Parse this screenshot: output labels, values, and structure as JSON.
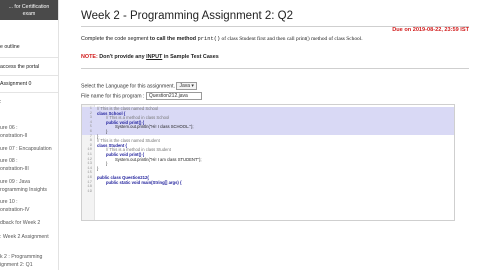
{
  "sidebar": {
    "header": [
      "... for Certification",
      "exam"
    ],
    "items": [
      {
        "text": "e outline",
        "style": "dark"
      },
      {
        "text": "access the portal",
        "style": "dark"
      },
      {
        "text": "Assignment 0",
        "style": "dark"
      },
      {
        "text": ":",
        "style": "dark"
      },
      {
        "text": "ure 06 :",
        "style": "muted"
      },
      {
        "text": "onstration-II",
        "style": "muted"
      },
      {
        "text": "ure 07 : Encapsulation",
        "style": "muted"
      },
      {
        "text": "ure 08 :",
        "style": "muted"
      },
      {
        "text": "onstration-III",
        "style": "muted"
      },
      {
        "text": "ure 09 : Java",
        "style": "muted"
      },
      {
        "text": "rogramming Insights",
        "style": "muted"
      },
      {
        "text": "ure 10 :",
        "style": "muted"
      },
      {
        "text": "onstration-IV",
        "style": "muted"
      },
      {
        "text": "dback for Week 2",
        "style": "muted"
      },
      {
        "text": ": Week 2 Assignment",
        "style": "muted"
      },
      {
        "text": "k 2 : Programming",
        "style": "muted"
      },
      {
        "text": "ignment 2: Q1",
        "style": "muted"
      }
    ]
  },
  "page": {
    "title": "Week 2 - Programming Assignment 2: Q2",
    "due": "Due on 2019-08-22, 23:59 IST",
    "instruction": {
      "before": "Complete the code segment ",
      "bold": "to call the method",
      "code": "print()",
      "after": " of class Student first and then call print() method of class School."
    },
    "note": {
      "label": "NOTE:",
      "before": " Don't provide any ",
      "input_word": "INPUT",
      "after": " in Sample Test Cases"
    },
    "language_label": "Select the Language for this assignment.",
    "language_value": "Java",
    "filename_label": "File name for this program :",
    "filename_value": "Question212.java"
  },
  "editor": {
    "lines": [
      {
        "n": "1",
        "text": "// This is the class named School",
        "type": "comment",
        "indent": 0,
        "hl": true
      },
      {
        "n": "2",
        "text": "class School {",
        "type": "kw",
        "indent": 0,
        "hl": true
      },
      {
        "n": "3",
        "text": "// This is a method in class School",
        "type": "comment",
        "indent": 1,
        "hl": true
      },
      {
        "n": "4",
        "text": "public void print() {",
        "type": "kw",
        "indent": 1,
        "hl": true
      },
      {
        "n": "5",
        "text": "System.out.println(\"Hi! I class SCHOOL.\");",
        "type": "code",
        "indent": 2,
        "hl": true
      },
      {
        "n": "6",
        "text": "}",
        "type": "code",
        "indent": 1,
        "hl": true
      },
      {
        "n": "7",
        "text": "}",
        "type": "code",
        "indent": 0,
        "hl": false
      },
      {
        "n": "8",
        "text": "// This is the class named Student",
        "type": "comment",
        "indent": 0,
        "hl": false
      },
      {
        "n": "9",
        "text": "class Student {",
        "type": "kw",
        "indent": 0,
        "hl": false
      },
      {
        "n": "10",
        "text": "// This is a method in class Student",
        "type": "comment",
        "indent": 1,
        "hl": false
      },
      {
        "n": "11",
        "text": "public void print() {",
        "type": "kw",
        "indent": 1,
        "hl": false
      },
      {
        "n": "12",
        "text": "System.out.println(\"Hi! I am class STUDENT\");",
        "type": "code",
        "indent": 2,
        "hl": false
      },
      {
        "n": "13",
        "text": "}",
        "type": "code",
        "indent": 1,
        "hl": false
      },
      {
        "n": "14",
        "text": "}",
        "type": "code",
        "indent": 0,
        "hl": false
      },
      {
        "n": "15",
        "text": "",
        "type": "code",
        "indent": 0,
        "hl": false
      },
      {
        "n": "16",
        "text": "public class Question212{",
        "type": "kw",
        "indent": 0,
        "hl": false
      },
      {
        "n": "17",
        "text": "public static void main(String[] args) {",
        "type": "kw",
        "indent": 1,
        "hl": false
      },
      {
        "n": "18",
        "text": "",
        "type": "code",
        "indent": 0,
        "hl": false
      },
      {
        "n": "19",
        "text": "",
        "type": "code",
        "indent": 0,
        "hl": false
      }
    ]
  },
  "colors": {
    "due": "#d11a1a",
    "highlight": "#d9d9f5",
    "sidebar_header": "#4a4a4a"
  }
}
